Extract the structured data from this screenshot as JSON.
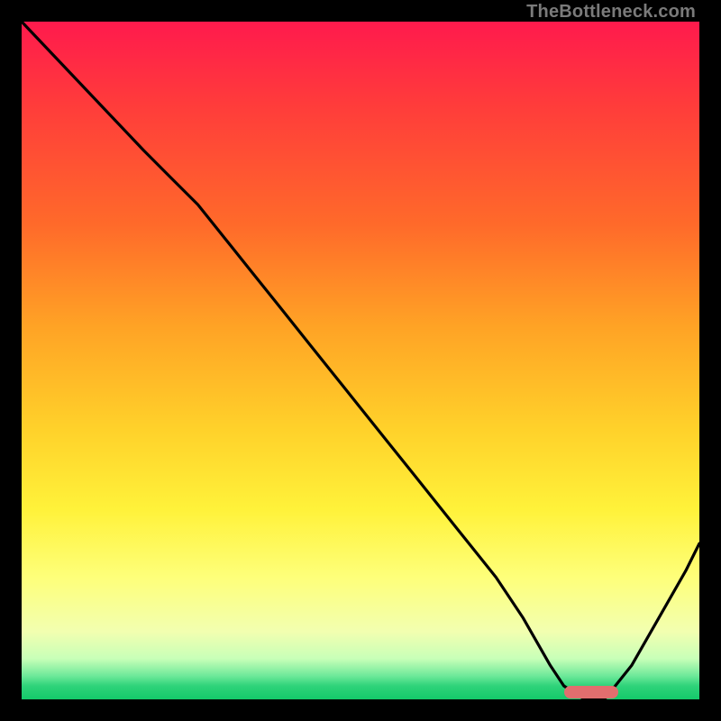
{
  "watermark": "TheBottleneck.com",
  "colors": {
    "background": "#000000",
    "curve": "#000000",
    "marker": "#e26e6e"
  },
  "chart_data": {
    "type": "line",
    "title": "",
    "xlabel": "",
    "ylabel": "",
    "xlim": [
      0,
      100
    ],
    "ylim": [
      0,
      100
    ],
    "grid": false,
    "legend": false,
    "series": [
      {
        "name": "bottleneck-curve",
        "x": [
          0,
          18,
          22,
          26,
          30,
          34,
          38,
          42,
          46,
          50,
          54,
          58,
          62,
          66,
          70,
          74,
          78,
          80,
          83,
          86,
          90,
          94,
          98,
          100
        ],
        "values": [
          100,
          81,
          77,
          73,
          68,
          63,
          58,
          53,
          48,
          43,
          38,
          33,
          28,
          23,
          18,
          12,
          5,
          2,
          0,
          0,
          5,
          12,
          19,
          23
        ]
      }
    ],
    "optimal_range": {
      "x_start": 80,
      "x_end": 88,
      "y": 1
    }
  }
}
